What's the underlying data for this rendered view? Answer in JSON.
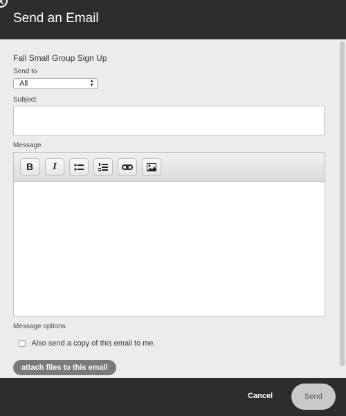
{
  "header": {
    "title": "Send an Email",
    "close_glyph": "✕"
  },
  "form": {
    "name": "Fall Small Group Sign Up",
    "send_to_label": "Send to",
    "send_to_value": "All",
    "subject_label": "Subject",
    "subject_value": "",
    "message_label": "Message",
    "toolbar": {
      "bold": "B",
      "italic": "I"
    },
    "options_label": "Message options",
    "copy_label": "Also send a copy of this email to me.",
    "attach_label": "attach files to this email"
  },
  "footer": {
    "cancel_label": "Cancel",
    "send_label": "Send"
  }
}
